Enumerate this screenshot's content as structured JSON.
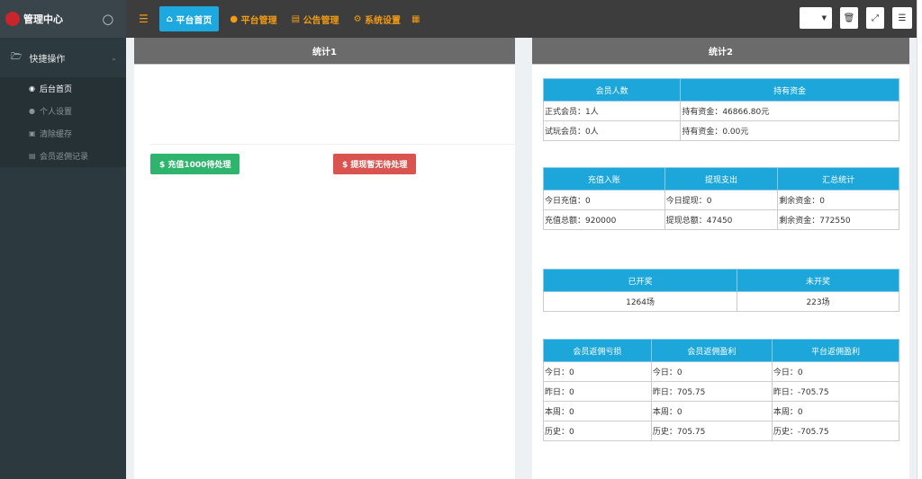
{
  "app": {
    "title": "管理中心"
  },
  "sidebar": {
    "group": "快捷操作",
    "items": [
      {
        "label": "后台首页",
        "icon": "dashboard-icon",
        "active": true
      },
      {
        "label": "个人设置",
        "icon": "user-icon"
      },
      {
        "label": "清除缓存",
        "icon": "trash-icon"
      },
      {
        "label": "会员返佣记录",
        "icon": "list-icon"
      }
    ]
  },
  "topnav": [
    {
      "label": "平台首页",
      "icon": "home-icon",
      "active": true
    },
    {
      "label": "平台管理",
      "icon": "user-icon"
    },
    {
      "label": "公告管理",
      "icon": "list-icon"
    },
    {
      "label": "系统设置",
      "icon": "gear-icon"
    }
  ],
  "colors": {
    "accent": "#1da6d9",
    "nav": "#f39c12",
    "green": "#2fb46e",
    "red": "#d9534f"
  },
  "panel1": {
    "title": "统计1",
    "recharge_btn": "$ 充值1000待处理",
    "withdraw_btn": "$ 提现暂无待处理"
  },
  "panel2": {
    "title": "统计2",
    "t1": {
      "headers": [
        "会员人数",
        "持有资金"
      ],
      "rows": [
        [
          "正式会员：1人",
          "持有资金：46866.80元"
        ],
        [
          "试玩会员：0人",
          "持有资金：0.00元"
        ]
      ]
    },
    "t2": {
      "headers": [
        "充值入账",
        "提现支出",
        "汇总统计"
      ],
      "rows": [
        [
          "今日充值：0",
          "今日提现：0",
          "剩余资金：0"
        ],
        [
          "充值总额：920000",
          "提现总额：47450",
          "剩余资金：772550"
        ]
      ]
    },
    "t3": {
      "headers": [
        "已开奖",
        "未开奖"
      ],
      "rows": [
        [
          "1264场",
          "223场"
        ]
      ]
    },
    "t4": {
      "headers": [
        "会员返佣亏损",
        "会员返佣盈利",
        "平台返佣盈利"
      ],
      "rows": [
        [
          "今日：0",
          "今日：0",
          "今日：0"
        ],
        [
          "昨日：0",
          "昨日：705.75",
          "昨日：-705.75"
        ],
        [
          "本周：0",
          "本周：0",
          "本周：0"
        ],
        [
          "历史：0",
          "历史：705.75",
          "历史：-705.75"
        ]
      ]
    }
  }
}
